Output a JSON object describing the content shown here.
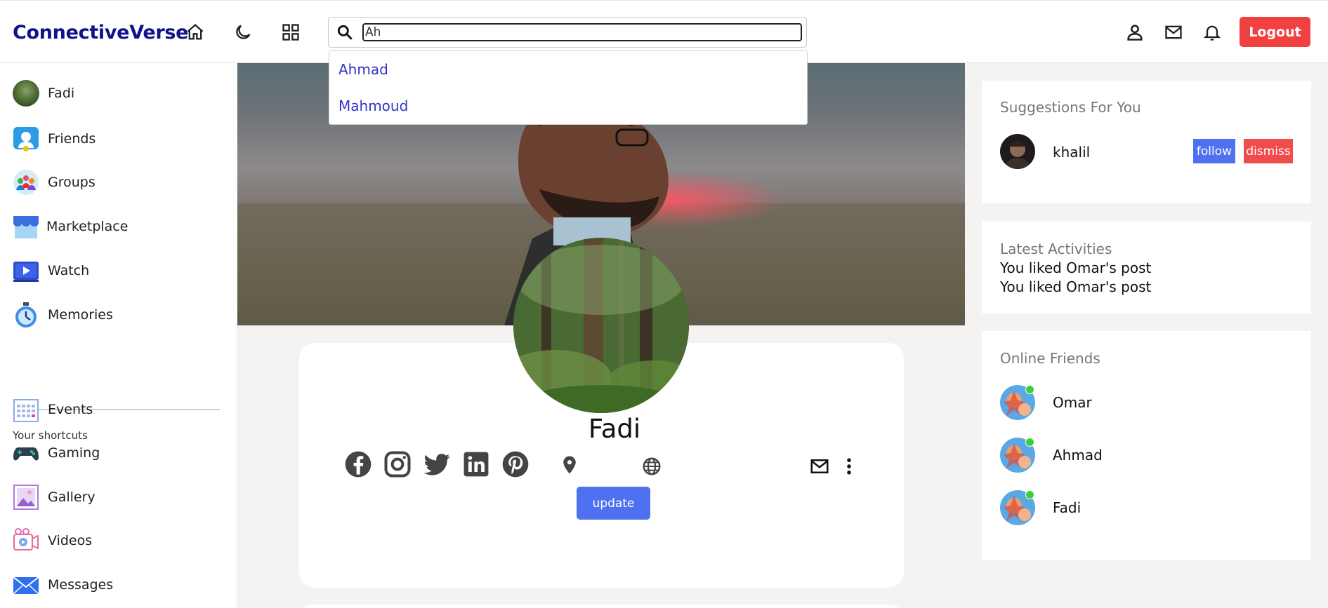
{
  "app": {
    "title": "ConnectiveVerse"
  },
  "search": {
    "value": "Ah",
    "suggestions": [
      "Ahmad",
      "Mahmoud"
    ]
  },
  "header": {
    "logout_label": "Logout"
  },
  "sidebar": {
    "items": [
      {
        "label": "Fadi",
        "icon": "avatar"
      },
      {
        "label": "Friends",
        "icon": "friends-icon"
      },
      {
        "label": "Groups",
        "icon": "groups-icon"
      },
      {
        "label": "Marketplace",
        "icon": "marketplace-icon"
      },
      {
        "label": "Watch",
        "icon": "watch-icon"
      },
      {
        "label": "Memories",
        "icon": "memories-icon"
      }
    ],
    "shortcuts_title": "Your shortcuts",
    "shortcuts": [
      {
        "label": "Events",
        "icon": "events-icon"
      },
      {
        "label": "Gaming",
        "icon": "gaming-icon"
      },
      {
        "label": "Gallery",
        "icon": "gallery-icon"
      },
      {
        "label": "Videos",
        "icon": "videos-icon"
      },
      {
        "label": "Messages",
        "icon": "messages-icon"
      }
    ]
  },
  "profile": {
    "name": "Fadi",
    "update_label": "update"
  },
  "suggestions": {
    "title": "Suggestions For You",
    "user": "khalil",
    "follow_label": "follow",
    "dismiss_label": "dismiss"
  },
  "activities": {
    "title": "Latest Activities",
    "items": [
      "You liked Omar's post",
      "You liked Omar's post"
    ]
  },
  "online": {
    "title": "Online Friends",
    "friends": [
      "Omar",
      "Ahmad",
      "Fadi"
    ]
  },
  "colors": {
    "brand": "#12128a",
    "logout": "#f04040",
    "primary": "#4f70ef",
    "online": "#35d335"
  }
}
